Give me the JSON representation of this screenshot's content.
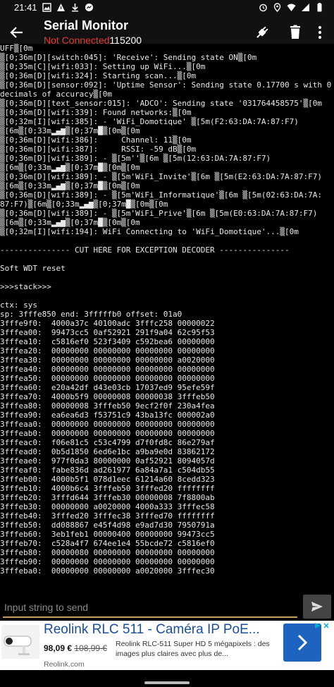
{
  "status_bar": {
    "time": "21:41",
    "left_icons": [
      "image-icon",
      "alert-icon",
      "download-icon",
      "messenger-icon"
    ],
    "right_icons": [
      "alarm-icon",
      "location-icon",
      "wifi-icon",
      "signal-icon",
      "battery-icon"
    ]
  },
  "app_bar": {
    "title": "Serial Monitor",
    "connection_status": "Not Connected",
    "baud_rate": "115200",
    "status_color": "#e53935"
  },
  "terminal": {
    "lines": [
      "UFF▒[0m",
      "▒[0;36m[D][switch:045]: 'Receive': Sending state ON▒[0m",
      "▒[0;35m[C][wifi:033]: Setting up WiFi...▒[0m",
      "▒[0;36m[D][wifi:324]: Starting scan...▒[0m",
      "▒[0;36m[D][sensor:092]: 'Uptime Sensor': Sending state 0.17700 s with 0",
      "decimals of accuracy▒[0m",
      "▒[0;36m[D][text_sensor:015]: 'ADCO': Sending state '031764458575'▒[0m",
      "▒[0;36m[D][wifi:339]: Found networks:▒[0m",
      "▒[0;32m[I][wifi:385]: - 'WiFi_Domotique' ▒[5m(F2:63:DA:7A:87:F7)",
      "▒[6m▒[0;33m▂▄▆▒[0;37m█▒[0m▒[0m",
      "▒[0;36m[D][wifi:386]:     Channel: 11▒[0m",
      "▒[0;36m[D][wifi:387]:     RSSI: -59 dB▒[0m",
      "▒[0;36m[D][wifi:389]: - ▒[5m''▒[6m ▒[5m(12:63:DA:7A:87:F7)",
      "▒[6m▒[0;33m▂▄▆▒[0;37m█▒[0m▒[0m",
      "▒[0;36m[D][wifi:389]: - ▒[5m'WiFi_Invite'▒[6m ▒[5m(E2:63:DA:7A:87:F7)",
      "▒[6m▒[0;33m▂▄▆▒[0;37m█▒[0m▒[0m",
      "▒[0;36m[D][wifi:389]: - ▒[5m'WiFi_Informatique'▒[6m ▒[5m(02:63:DA:7A:",
      "87:F7)▒[6m▒[0;33m▂▄▆▒[0;37m█▒[0m▒[0m",
      "▒[0;36m[D][wifi:389]: - ▒[5m'WiFi_Prive'▒[6m ▒[5m(E0:63:DA:7A:87:F7)",
      "▒[6m▒[0;33m▂▄▆▒[0;37m█▒[0m▒[0m",
      "▒[0;32m[I][wifi:194]: WiFi Connecting to 'WiFi_Domotique'...▒[0m",
      "",
      "--------------- CUT HERE FOR EXCEPTION DECODER ---------------",
      "",
      "Soft WDT reset",
      "",
      ">>>stack>>>",
      "",
      "ctx: sys",
      "sp: 3fffe850 end: 3fffffb0 offset: 01a0",
      "3fffe9f0:  4000a37c 40100adc 3fffc258 00000022",
      "3fffea00:  99473cc5 0af52921 291f9a04 62c95f53",
      "3fffea10:  c5816ef0 523f3409 c592bea6 00000000",
      "3fffea20:  00000000 00000000 00000000 00000000",
      "3fffea30:  00000000 00000000 00000000 a0020000",
      "3fffea40:  00000000 00000000 00000000 00000000",
      "3fffea50:  00000000 00000000 00000000 00000000",
      "3fffea60:  e20a42df d43e03cb 17037ed9 95efe59f",
      "3fffea70:  4000b5f9 00000008 00000038 3fffeb50",
      "3fffea80:  00000008 3fffeb50 9ecf2f0f 230a4fea",
      "3fffea90:  ea6ea6d3 f53751c9 43ba13fc 000002a0",
      "3fffeaa0:  00000000 00000000 00000000 00000000",
      "3fffeab0:  00000000 00000000 00000000 00000000",
      "3fffeac0:  f06e81c5 c53c4799 d7f0fd8c 86e279af",
      "3fffead0:  0b5d1850 6ed6e1bc a9ba9e0d 83862172",
      "3fffeae0:  977f0da3 80000000 0af52921 8094057d",
      "3fffeaf0:  fabe836d ad261977 6a84a7a1 c504db55",
      "3fffeb00:  4000b5f1 078d1eec 61214a60 8cedd323",
      "3fffeb10:  4000b6c4 3fffeb50 3fffed20 ffffffff",
      "3fffeb20:  3fffd644 3fffeb30 00000008 7f8800ab",
      "3fffeb30:  00000000 a0020000 4000a333 3fffec58",
      "3fffeb40:  3fffed20 3fffec38 3fffed70 ffffffff",
      "3fffeb50:  dd088867 e45f4d98 e9ad7d30 7950791a",
      "3fffeb60:  3eb1feb1 00000400 00000000 99473cc5",
      "3fffeb70:  c528a4f7 674ee1e4 55bcde72 c5816ef0",
      "3fffeb80:  00000080 00000000 00000000 00000000",
      "3fffeb90:  00000000 00000000 00000000 00000000",
      "3fffeba0:  00000000 00000000 a0020000 3fffec30"
    ]
  },
  "input": {
    "placeholder": "Input string to send",
    "accent_color": "#c79b5e"
  },
  "ad": {
    "title": "Reolink RLC 511 - Caméra IP PoE...",
    "price": "98,09 €",
    "old_price": "108,99 €",
    "description": "Reolink RLC-511 Super HD 5 mégapixels : des images plus claires avec plus de...",
    "domain": "Reolink.com",
    "accent_color": "#1e63c0"
  }
}
